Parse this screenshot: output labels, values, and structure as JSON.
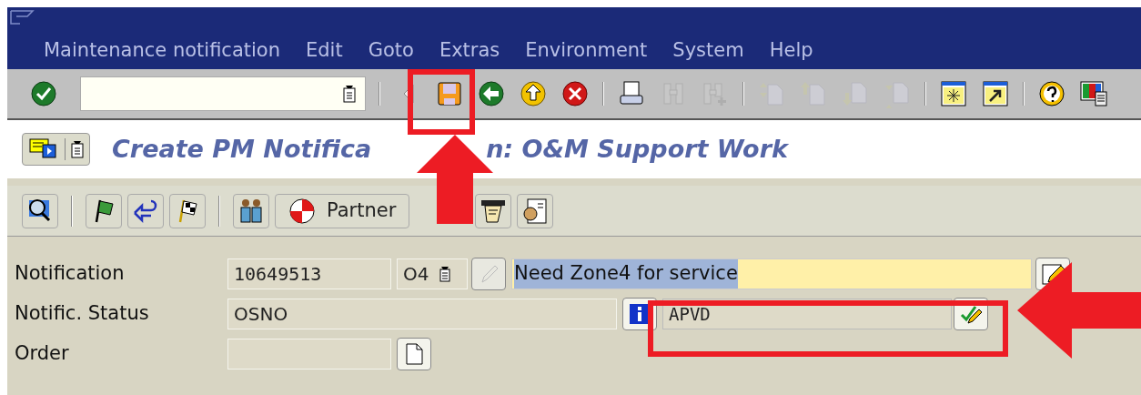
{
  "menu": [
    {
      "label": "Maintenance notification"
    },
    {
      "label": "Edit"
    },
    {
      "label": "Goto"
    },
    {
      "label": "Extras"
    },
    {
      "label": "Environment"
    },
    {
      "label": "System"
    },
    {
      "label": "Help"
    }
  ],
  "toolbar": [
    {
      "kind": "ok",
      "disabled": false
    },
    {
      "kind": "command"
    },
    {
      "kind": "sep"
    },
    {
      "kind": "collapse",
      "disabled": false
    },
    {
      "kind": "save",
      "disabled": false
    },
    {
      "kind": "back",
      "disabled": false
    },
    {
      "kind": "exit",
      "disabled": false
    },
    {
      "kind": "cancel",
      "disabled": false
    },
    {
      "kind": "sep"
    },
    {
      "kind": "print",
      "disabled": false
    },
    {
      "kind": "find",
      "disabled": true
    },
    {
      "kind": "find_next",
      "disabled": true
    },
    {
      "kind": "sep"
    },
    {
      "kind": "first_page",
      "disabled": true
    },
    {
      "kind": "prev_page",
      "disabled": true
    },
    {
      "kind": "next_page",
      "disabled": true
    },
    {
      "kind": "last_page",
      "disabled": true
    },
    {
      "kind": "sep"
    },
    {
      "kind": "new_session",
      "disabled": false
    },
    {
      "kind": "shortcut",
      "disabled": false
    },
    {
      "kind": "sep"
    },
    {
      "kind": "help",
      "disabled": false
    },
    {
      "kind": "layout",
      "disabled": false
    }
  ],
  "title_parts": [
    "Create PM Notifica",
    "n: O&M Support Work"
  ],
  "app_toolbar": [
    {
      "kind": "display_object"
    },
    {
      "kind": "sep"
    },
    {
      "kind": "flag_green"
    },
    {
      "kind": "undo"
    },
    {
      "kind": "flag_checkered"
    },
    {
      "kind": "sep"
    },
    {
      "kind": "people"
    },
    {
      "kind": "partner",
      "label": "Partner"
    },
    {
      "kind": "hidden"
    },
    {
      "kind": "note"
    },
    {
      "kind": "contact"
    }
  ],
  "rows": [
    {
      "kind": "notification",
      "label": "Notification",
      "value": "10649513",
      "type": "O4",
      "description": "Need Zone4 for service",
      "description_selected": true
    },
    {
      "kind": "status",
      "label": "Notific. Status",
      "value": "OSNO",
      "user_status": "APVD"
    },
    {
      "kind": "order",
      "label": "Order",
      "value": ""
    }
  ]
}
